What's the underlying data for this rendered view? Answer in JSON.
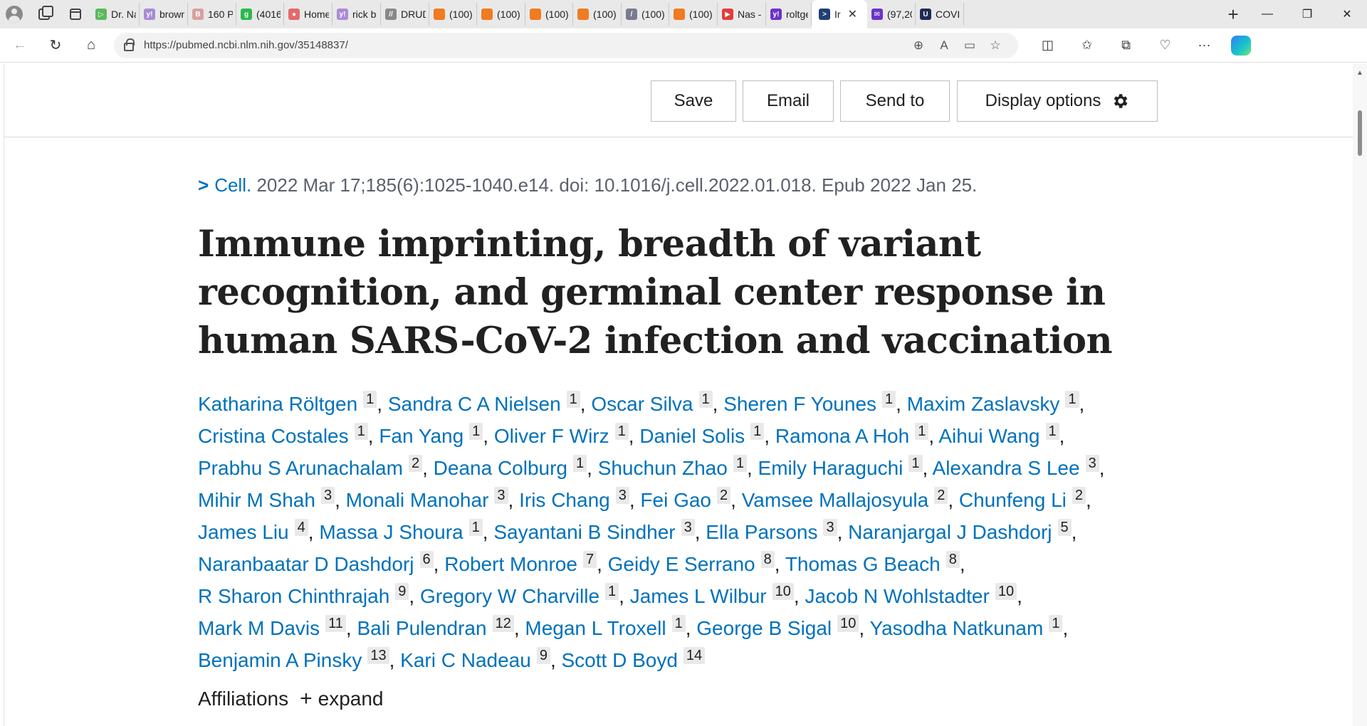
{
  "browser": {
    "tabs": [
      {
        "title": "Dr. Na",
        "color": "#5cb85c",
        "glyph": "▷"
      },
      {
        "title": "brown",
        "color": "#a98bd6",
        "glyph": "y!"
      },
      {
        "title": "160 Pl",
        "color": "#d9a0a0",
        "glyph": "B"
      },
      {
        "title": "(4016",
        "color": "#2db84d",
        "glyph": "g"
      },
      {
        "title": "Home",
        "color": "#e46a6a",
        "glyph": "●"
      },
      {
        "title": "rick b",
        "color": "#a98bd6",
        "glyph": "y!"
      },
      {
        "title": "DRUD",
        "color": "#888888",
        "glyph": "//"
      },
      {
        "title": "(100)",
        "color": "#f07b22",
        "glyph": ""
      },
      {
        "title": "(100)",
        "color": "#f07b22",
        "glyph": ""
      },
      {
        "title": "(100)",
        "color": "#f07b22",
        "glyph": ""
      },
      {
        "title": "(100)",
        "color": "#f07b22",
        "glyph": ""
      },
      {
        "title": "(100)",
        "color": "#7a7a90",
        "glyph": "/"
      },
      {
        "title": "(100)",
        "color": "#f07b22",
        "glyph": ""
      },
      {
        "title": "Nas -",
        "color": "#e33b3b",
        "glyph": "▶"
      },
      {
        "title": "roltge",
        "color": "#6c33c9",
        "glyph": "y!"
      }
    ],
    "active_tab": {
      "title": "Ir",
      "color": "#1f3f73",
      "glyph": ">"
    },
    "tabs_after": [
      {
        "title": "(97,20",
        "color": "#6c33c9",
        "glyph": "✉"
      },
      {
        "title": "COVID",
        "color": "#1f2a55",
        "glyph": "U"
      }
    ],
    "url": "https://pubmed.ncbi.nlm.nih.gov/35148837/"
  },
  "actions": {
    "save": "Save",
    "email": "Email",
    "send_to": "Send to",
    "display_options": "Display options"
  },
  "citation": {
    "journal": "Cell",
    "details": "2022 Mar 17;185(6):1025-1040.e14. doi: 10.1016/j.cell.2022.01.018. Epub 2022 Jan 25."
  },
  "article": {
    "title": "Immune imprinting, breadth of variant recognition, and germinal center response in human SARS-CoV-2 infection and vaccination"
  },
  "authors": [
    {
      "name": "Katharina Röltgen",
      "aff": "1"
    },
    {
      "name": "Sandra C A Nielsen",
      "aff": "1"
    },
    {
      "name": "Oscar Silva",
      "aff": "1"
    },
    {
      "name": "Sheren F Younes",
      "aff": "1"
    },
    {
      "name": "Maxim Zaslavsky",
      "aff": "1"
    },
    {
      "name": "Cristina Costales",
      "aff": "1"
    },
    {
      "name": "Fan Yang",
      "aff": "1"
    },
    {
      "name": "Oliver F Wirz",
      "aff": "1"
    },
    {
      "name": "Daniel Solis",
      "aff": "1"
    },
    {
      "name": "Ramona A Hoh",
      "aff": "1"
    },
    {
      "name": "Aihui Wang",
      "aff": "1"
    },
    {
      "name": "Prabhu S Arunachalam",
      "aff": "2"
    },
    {
      "name": "Deana Colburg",
      "aff": "1"
    },
    {
      "name": "Shuchun Zhao",
      "aff": "1"
    },
    {
      "name": "Emily Haraguchi",
      "aff": "1"
    },
    {
      "name": "Alexandra S Lee",
      "aff": "3"
    },
    {
      "name": "Mihir M Shah",
      "aff": "3"
    },
    {
      "name": "Monali Manohar",
      "aff": "3"
    },
    {
      "name": "Iris Chang",
      "aff": "3"
    },
    {
      "name": "Fei Gao",
      "aff": "2"
    },
    {
      "name": "Vamsee Mallajosyula",
      "aff": "2"
    },
    {
      "name": "Chunfeng Li",
      "aff": "2"
    },
    {
      "name": "James Liu",
      "aff": "4"
    },
    {
      "name": "Massa J Shoura",
      "aff": "1"
    },
    {
      "name": "Sayantani B Sindher",
      "aff": "3"
    },
    {
      "name": "Ella Parsons",
      "aff": "3"
    },
    {
      "name": "Naranjargal J Dashdorj",
      "aff": "5"
    },
    {
      "name": "Naranbaatar D Dashdorj",
      "aff": "6"
    },
    {
      "name": "Robert Monroe",
      "aff": "7"
    },
    {
      "name": "Geidy E Serrano",
      "aff": "8"
    },
    {
      "name": "Thomas G Beach",
      "aff": "8"
    },
    {
      "name": "R Sharon Chinthrajah",
      "aff": "9"
    },
    {
      "name": "Gregory W Charville",
      "aff": "1"
    },
    {
      "name": "James L Wilbur",
      "aff": "10"
    },
    {
      "name": "Jacob N Wohlstadter",
      "aff": "10"
    },
    {
      "name": "Mark M Davis",
      "aff": "11"
    },
    {
      "name": "Bali Pulendran",
      "aff": "12"
    },
    {
      "name": "Megan L Troxell",
      "aff": "1"
    },
    {
      "name": "George B Sigal",
      "aff": "10"
    },
    {
      "name": "Yasodha Natkunam",
      "aff": "1"
    },
    {
      "name": "Benjamin A Pinsky",
      "aff": "13"
    },
    {
      "name": "Kari C Nadeau",
      "aff": "9"
    },
    {
      "name": "Scott D Boyd",
      "aff": "14"
    }
  ],
  "affiliations": {
    "label": "Affiliations",
    "expand": "expand"
  }
}
